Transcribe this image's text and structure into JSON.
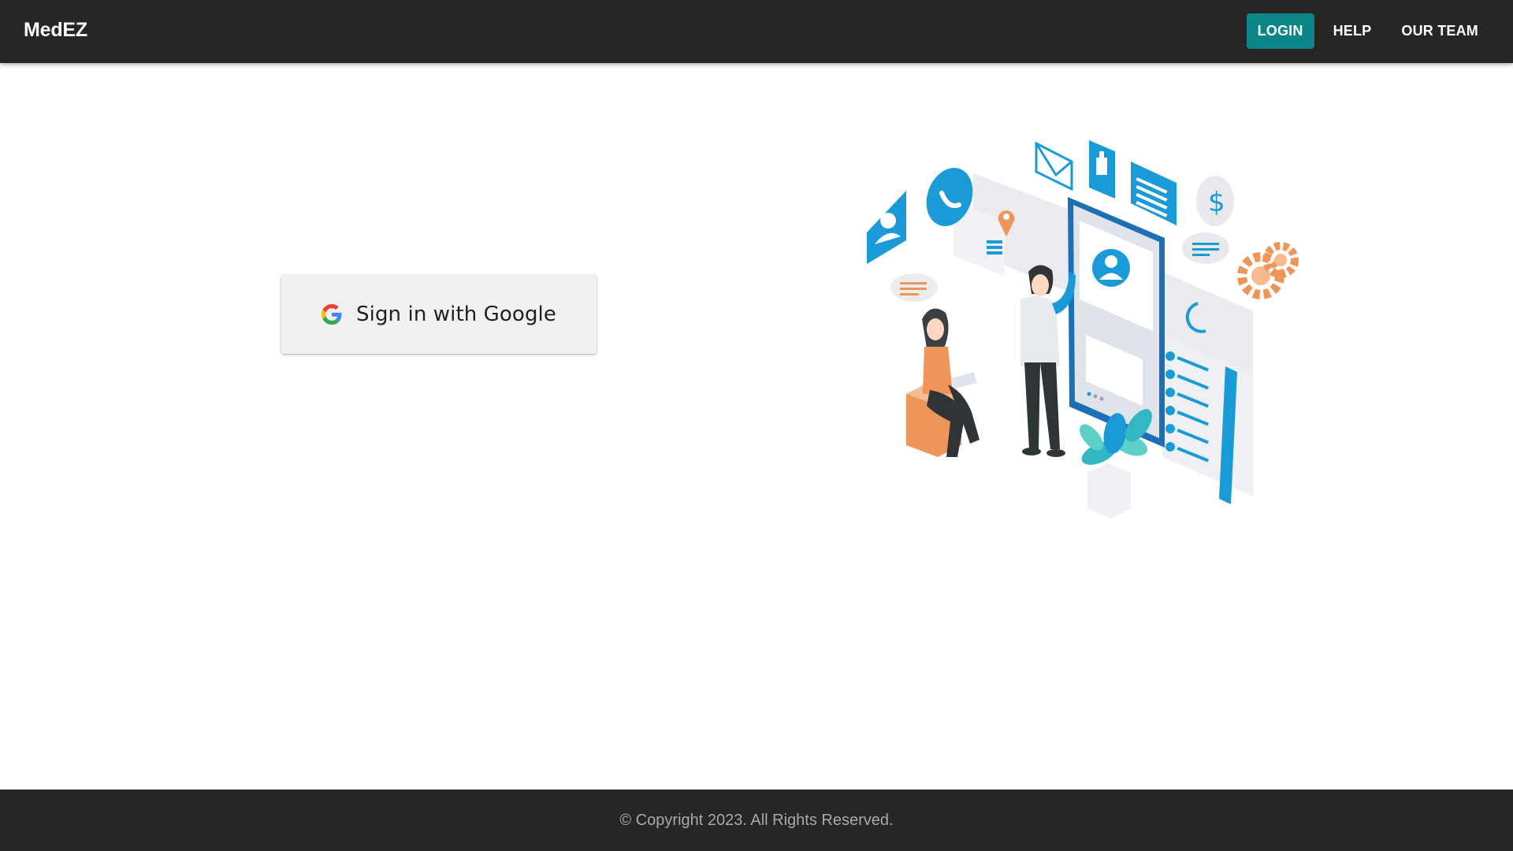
{
  "header": {
    "brand": "MedEZ",
    "nav": [
      {
        "label": "LOGIN",
        "active": true
      },
      {
        "label": "HELP",
        "active": false
      },
      {
        "label": "OUR TEAM",
        "active": false
      }
    ]
  },
  "signin": {
    "label": "Sign in with Google",
    "icon": "google-g-icon"
  },
  "illustration": {
    "icons": [
      "user-profile-icon",
      "phone-icon",
      "location-pin-icon",
      "mail-icon",
      "thumbs-up-icon",
      "document-icon",
      "dollar-icon",
      "gear-icon",
      "chat-bubble-icon"
    ]
  },
  "footer": {
    "copyright": "© Copyright 2023. All Rights Reserved."
  },
  "colors": {
    "header_bg": "#262626",
    "accent": "#0b8587",
    "button_bg": "#f1f1f1",
    "illustration_blue": "#1a9ad6",
    "illustration_orange": "#f0955a"
  }
}
